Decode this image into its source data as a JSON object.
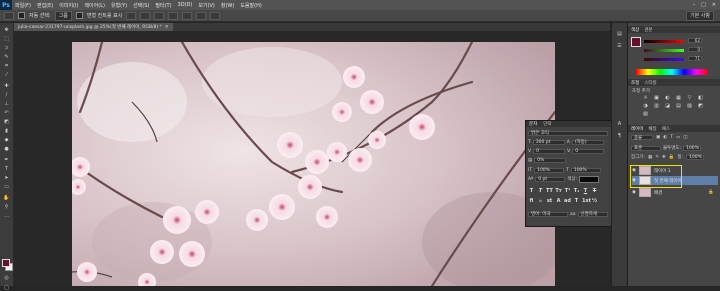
{
  "app": {
    "logo": "Ps"
  },
  "menu": [
    "파일(F)",
    "편집(E)",
    "이미지(I)",
    "레이어(L)",
    "유형(Y)",
    "선택(S)",
    "필터(T)",
    "3D(D)",
    "보기(V)",
    "창(W)",
    "도움말(H)"
  ],
  "window_controls": [
    "–",
    "□",
    "✕"
  ],
  "options": {
    "auto_select_label": "자동 선택:",
    "auto_select_value": "그룹",
    "show_transform_label": "변형 컨트롤 표시",
    "workspace": "기본 사항"
  },
  "document": {
    "tab_title": "julia-caesar-231797-unsplash.jpg @ 25%(첫 번째 레이어, RGB/8) *"
  },
  "character_panel": {
    "tabs": [
      "문자",
      "단락"
    ],
    "font_family": "맑은 고딕",
    "font_size": "300 pt",
    "leading": "(자동)",
    "tracking": "0",
    "kerning": "0",
    "percent_label": "0%",
    "vertical_scale": "100%",
    "horizontal_scale": "100%",
    "baseline": "0 pt",
    "color_label": "색상:",
    "type_buttons": [
      "T",
      "T",
      "TT",
      "Tт",
      "T¹",
      "T₁",
      "T",
      "T"
    ],
    "ot_buttons": [
      "fi",
      "ℴ",
      "st",
      "A",
      "ad",
      "T",
      "1st",
      "½"
    ],
    "language": "영어: 미국",
    "anti_alias_icon": "aa",
    "anti_alias": "선명하게"
  },
  "right_panel": {
    "color_tabs": [
      "색상",
      "견본"
    ],
    "r_value": "62",
    "g_value": "0",
    "b_value": "71",
    "r_color": "#a0174e",
    "adjust_tabs": [
      "조정",
      "스타일"
    ],
    "adjust_title": "조정 추가",
    "adjust_icons": [
      "☼",
      "▣",
      "◐",
      "▦",
      "▽",
      "◧",
      "◑",
      "▥",
      "◪",
      "▤",
      "▨",
      "◩",
      "▧"
    ],
    "layers_tabs": [
      "레이어",
      "채널",
      "패스"
    ],
    "kind_label": "종류",
    "blend_mode": "표준",
    "opacity_label": "불투명도:",
    "opacity": "100%",
    "lock_label": "잠그기:",
    "fill_label": "칠:",
    "fill": "100%",
    "layers": [
      {
        "name": "레이어 1",
        "visible": true
      },
      {
        "name": "첫 번째 레이어",
        "visible": true,
        "selected": true
      },
      {
        "name": "배경",
        "visible": true
      }
    ]
  },
  "colors": {
    "foreground": "#6b0d2e",
    "background": "#f2f2f2",
    "highlight": "#f2e200"
  }
}
